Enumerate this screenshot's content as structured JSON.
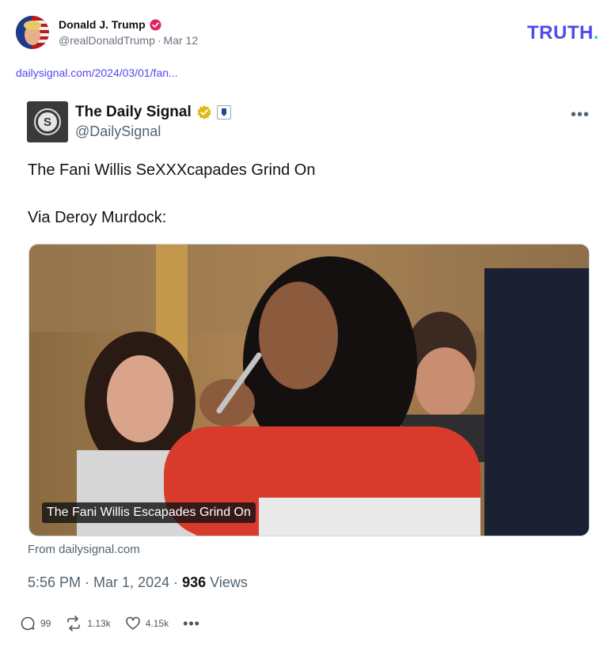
{
  "post": {
    "author_name": "Donald J. Trump",
    "handle": "@realDonaldTrump",
    "date": "Mar 12",
    "link_text": "dailysignal.com/2024/03/01/fan...",
    "brand": "TRUTH",
    "brand_dot": "."
  },
  "tweet": {
    "account_name": "The Daily Signal",
    "account_handle": "@DailySignal",
    "logo_letter": "S",
    "more": "•••",
    "text_line1": "The Fani Willis SeXXXcapades Grind On",
    "text_line2": "Via Deroy Murdock:",
    "media_caption": "The Fani Willis Escapades Grind On",
    "from_text": "From dailysignal.com",
    "time": "5:56 PM",
    "date": "Mar 1, 2024",
    "views_count": "936",
    "views_label": "Views"
  },
  "actions": {
    "replies": "99",
    "retruths": "1.13k",
    "likes": "4.15k",
    "more": "•••"
  },
  "colors": {
    "brand_purple": "#5448ee",
    "brand_teal": "#17e2c7",
    "verified_red": "#e0245e",
    "gold_check": "#e2b719"
  },
  "icons": [
    "verified-badge-icon",
    "gold-check-icon",
    "affiliate-badge-icon",
    "more-icon",
    "reply-icon",
    "retruth-icon",
    "like-icon"
  ]
}
